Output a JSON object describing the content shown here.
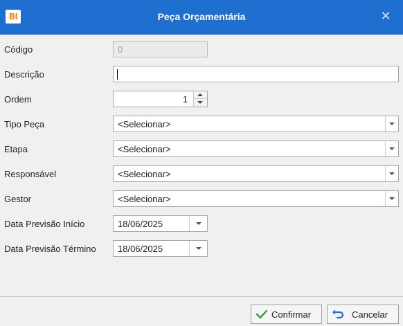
{
  "window": {
    "logo_text": "BI",
    "title": "Peça Orçamentária",
    "close_glyph": "✕"
  },
  "form": {
    "codigo": {
      "label": "Código",
      "value": "0"
    },
    "descricao": {
      "label": "Descrição",
      "value": ""
    },
    "ordem": {
      "label": "Ordem",
      "value": "1"
    },
    "tipo_peca": {
      "label": "Tipo Peça",
      "value": "<Selecionar>"
    },
    "etapa": {
      "label": "Etapa",
      "value": "<Selecionar>"
    },
    "responsavel": {
      "label": "Responsável",
      "value": "<Selecionar>"
    },
    "gestor": {
      "label": "Gestor",
      "value": "<Selecionar>"
    },
    "data_inicio": {
      "label": "Data Previsão Início",
      "value": "18/06/2025"
    },
    "data_termino": {
      "label": "Data Previsão Término",
      "value": "18/06/2025"
    }
  },
  "footer": {
    "confirm_label": "Confirmar",
    "cancel_label": "Cancelar"
  },
  "colors": {
    "titlebar": "#1e6fd0",
    "logo_accent": "#f18b1d",
    "confirm_icon": "#3a9a3a",
    "cancel_icon": "#1e6fd0"
  },
  "icons": {
    "close": "close-icon",
    "confirm": "checkmark-icon",
    "cancel": "undo-icon"
  }
}
